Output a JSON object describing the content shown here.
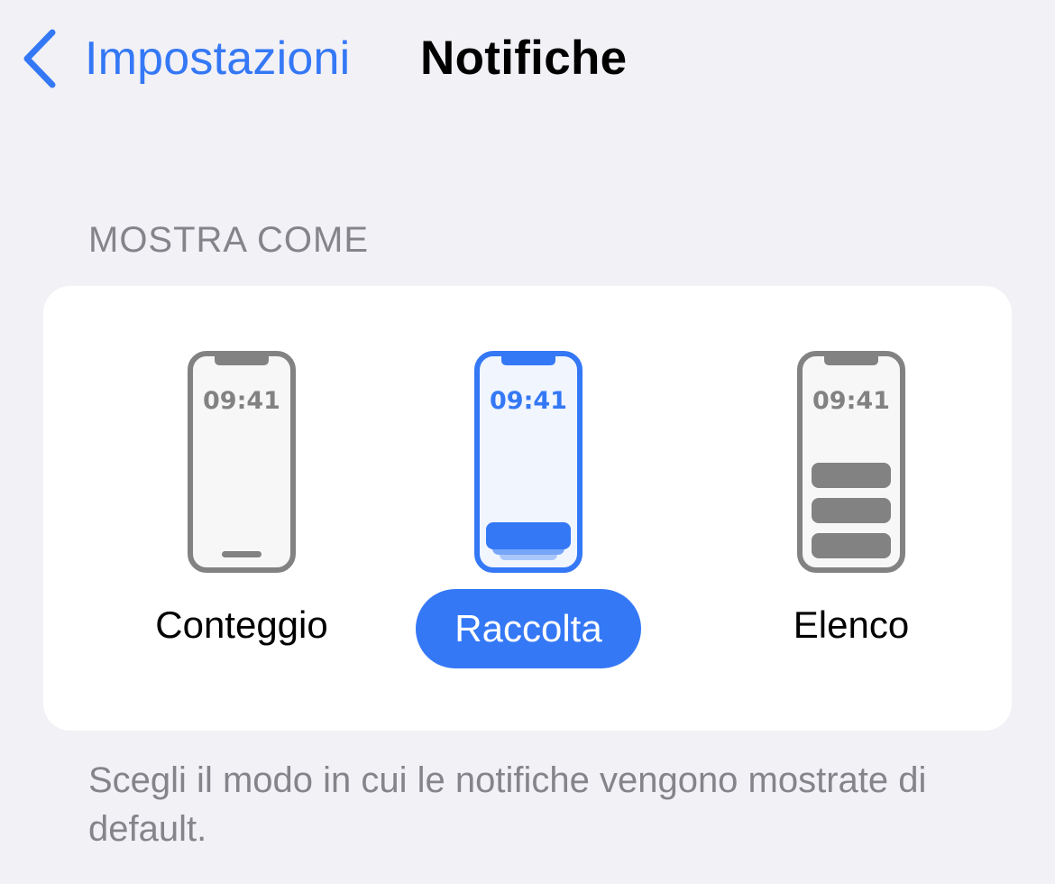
{
  "nav": {
    "back_label": "Impostazioni",
    "title": "Notifiche"
  },
  "section": {
    "header": "MOSTRA COME",
    "options": [
      {
        "label": "Conteggio",
        "time": "09:41",
        "selected": false
      },
      {
        "label": "Raccolta",
        "time": "09:41",
        "selected": true
      },
      {
        "label": "Elenco",
        "time": "09:41",
        "selected": false
      }
    ],
    "footer": "Scegli il modo in cui le notifiche vengono mostrate di default."
  },
  "colors": {
    "accent": "#3478f6",
    "background": "#f2f1f6",
    "secondary_text": "#85848a",
    "phone_outline": "#828282"
  }
}
